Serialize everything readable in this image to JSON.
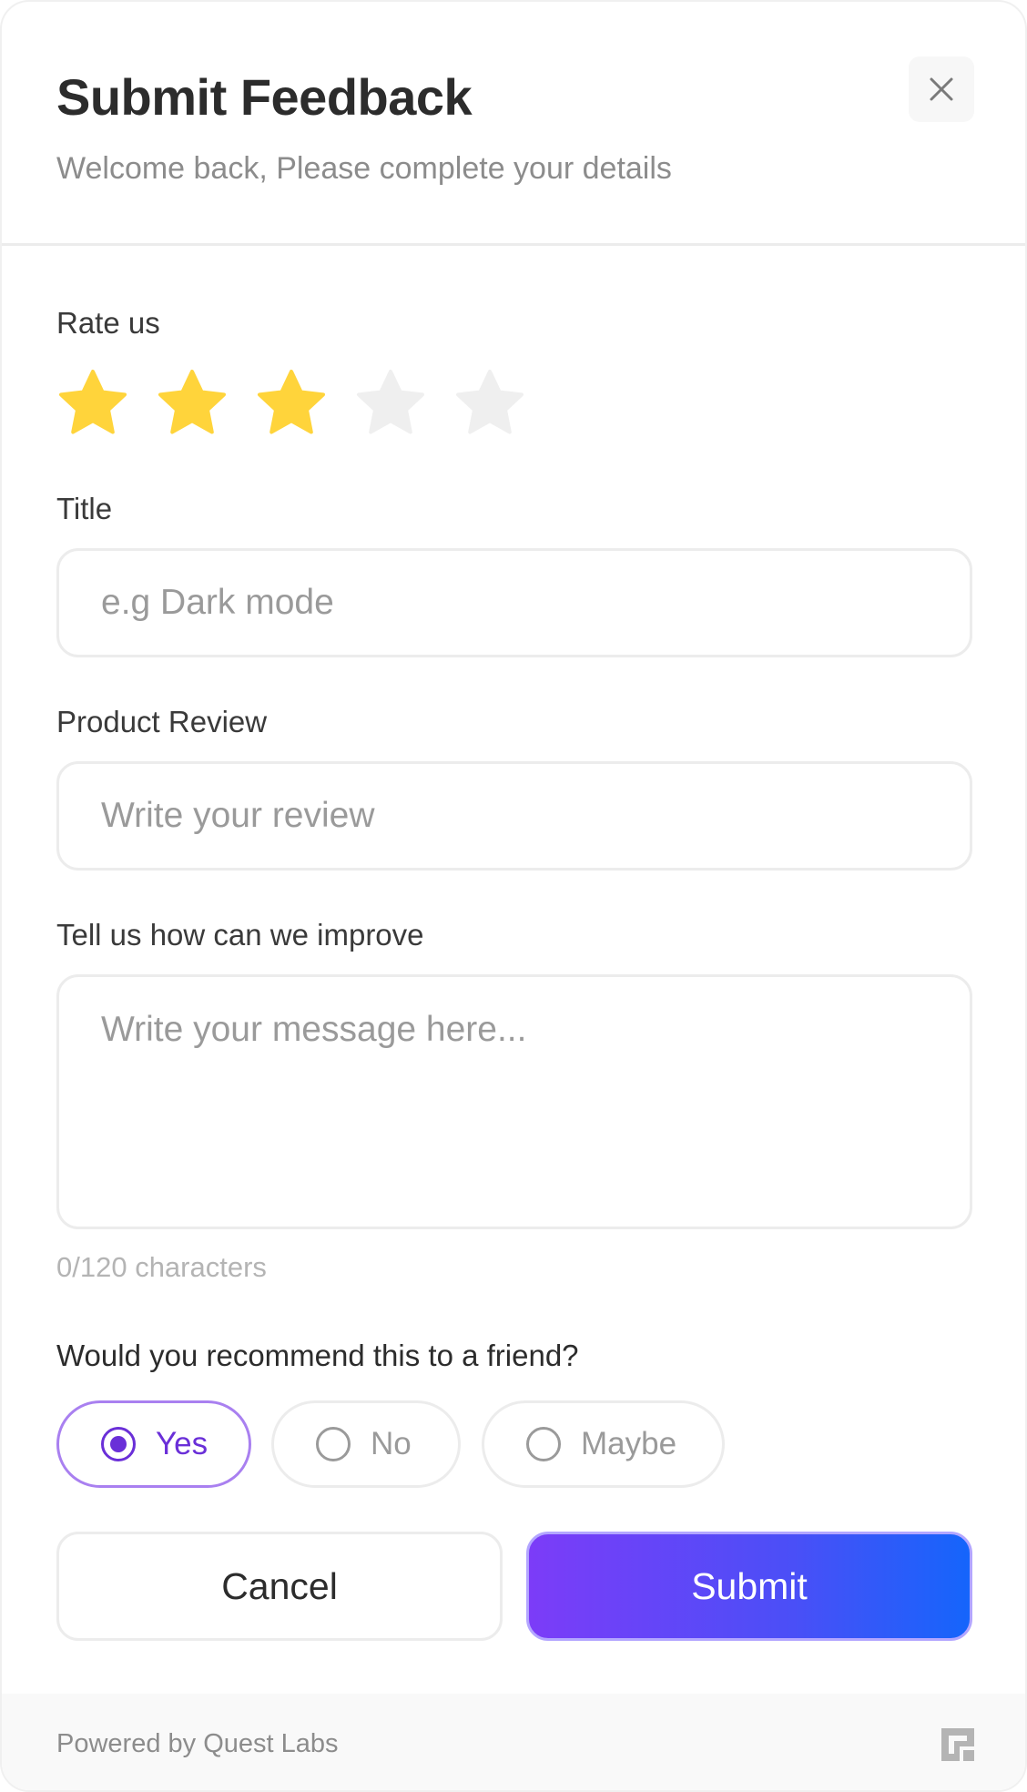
{
  "header": {
    "title": "Submit Feedback",
    "subtitle": "Welcome back, Please complete your details",
    "close_icon": "close-icon"
  },
  "rating": {
    "label": "Rate us",
    "value": 3,
    "max": 5,
    "filled_color": "#FFD43B",
    "empty_color": "#EFEFEF"
  },
  "title_field": {
    "label": "Title",
    "value": "",
    "placeholder": "e.g Dark mode"
  },
  "review_field": {
    "label": "Product Review",
    "value": "",
    "placeholder": "Write your review"
  },
  "improve_field": {
    "label": "Tell us how can we improve",
    "value": "",
    "placeholder": "Write your message here...",
    "counter": "0/120 characters"
  },
  "recommend": {
    "question": "Would you recommend this to a friend?",
    "options": [
      "Yes",
      "No",
      "Maybe"
    ],
    "selected": "Yes"
  },
  "actions": {
    "cancel_label": "Cancel",
    "submit_label": "Submit"
  },
  "footer": {
    "powered_by": "Powered by Quest Labs",
    "logo_icon": "quest-labs-logo-icon"
  },
  "colors": {
    "accent": "#6A2FD8",
    "gradient_start": "#7C3CF8",
    "gradient_end": "#1565FB"
  }
}
